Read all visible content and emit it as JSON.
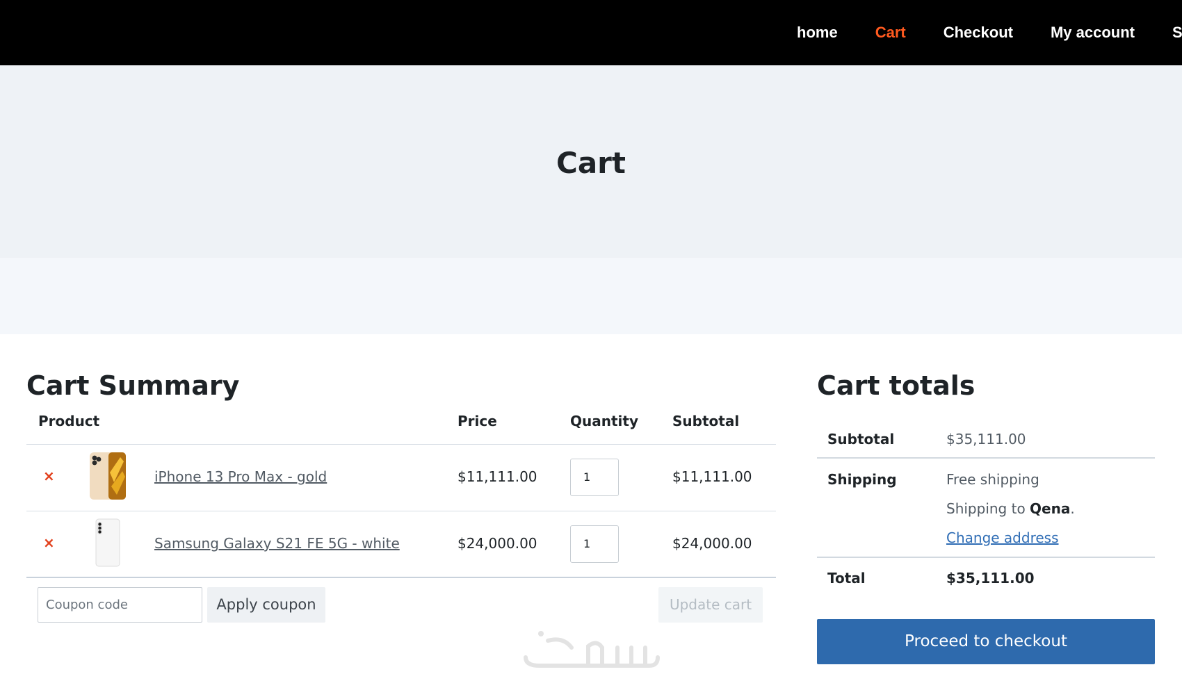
{
  "nav": {
    "items": [
      {
        "label": "home"
      },
      {
        "label": "Cart"
      },
      {
        "label": "Checkout"
      },
      {
        "label": "My account"
      },
      {
        "label": "S"
      }
    ],
    "active_color": "#ff5a1f"
  },
  "hero": {
    "title": "Cart"
  },
  "summary": {
    "title": "Cart Summary",
    "headers": {
      "product": "Product",
      "price": "Price",
      "quantity": "Quantity",
      "subtotal": "Subtotal"
    },
    "rows": [
      {
        "remove": "×",
        "name": "iPhone 13 Pro Max - gold",
        "price": "$11,111.00",
        "qty": "1",
        "subtotal": "$11,111.00",
        "thumb_icon": "iphone-gold-thumbnail"
      },
      {
        "remove": "×",
        "name": "Samsung Galaxy S21 FE 5G - white",
        "price": "$24,000.00",
        "qty": "1",
        "subtotal": "$24,000.00",
        "thumb_icon": "samsung-white-thumbnail"
      }
    ],
    "coupon_placeholder": "Coupon code",
    "apply_label": "Apply coupon",
    "update_label": "Update cart"
  },
  "totals": {
    "title": "Cart totals",
    "subtotal_label": "Subtotal",
    "subtotal_value": "$35,111.00",
    "shipping_label": "Shipping",
    "shipping_method": "Free shipping",
    "shipping_to_prefix": "Shipping to ",
    "shipping_to_place": "Qena",
    "shipping_to_suffix": ".",
    "change_address": "Change address",
    "total_label": "Total",
    "total_value": "$35,111.00",
    "checkout_label": "Proceed to checkout"
  },
  "colors": {
    "accent": "#2e6aad",
    "remove": "#e2401c"
  }
}
